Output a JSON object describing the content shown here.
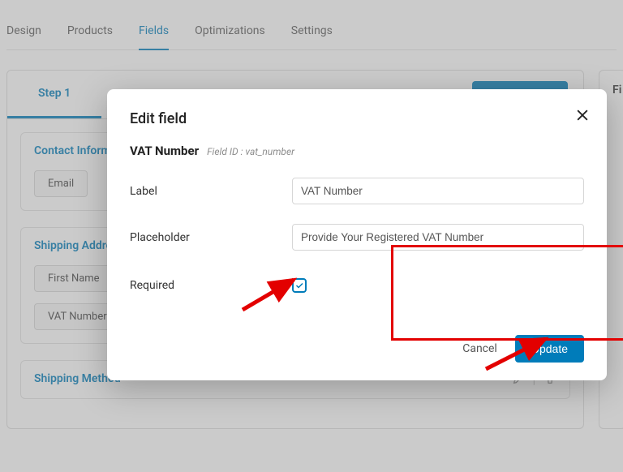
{
  "tabs": {
    "design": "Design",
    "products": "Products",
    "fields": "Fields",
    "optimizations": "Optimizations",
    "settings": "Settings",
    "active": "fields"
  },
  "step": {
    "label": "Step 1"
  },
  "side_panel_prefix": "Fi",
  "cards": {
    "contact": {
      "title": "Contact Information",
      "items": {
        "email": "Email"
      }
    },
    "shipping_addr": {
      "title": "Shipping Address",
      "items": {
        "first_name": "First Name",
        "vat_number": "VAT Number"
      }
    },
    "shipping_method": {
      "title": "Shipping Method"
    }
  },
  "modal": {
    "title": "Edit field",
    "field_name": "VAT Number",
    "field_id_label": "Field ID : vat_number",
    "rows": {
      "label": "Label",
      "placeholder": "Placeholder",
      "required": "Required"
    },
    "inputs": {
      "label_value": "VAT Number",
      "placeholder_value": "Provide Your Registered VAT Number"
    },
    "required_checked": true,
    "actions": {
      "cancel": "Cancel",
      "update": "Update"
    }
  }
}
